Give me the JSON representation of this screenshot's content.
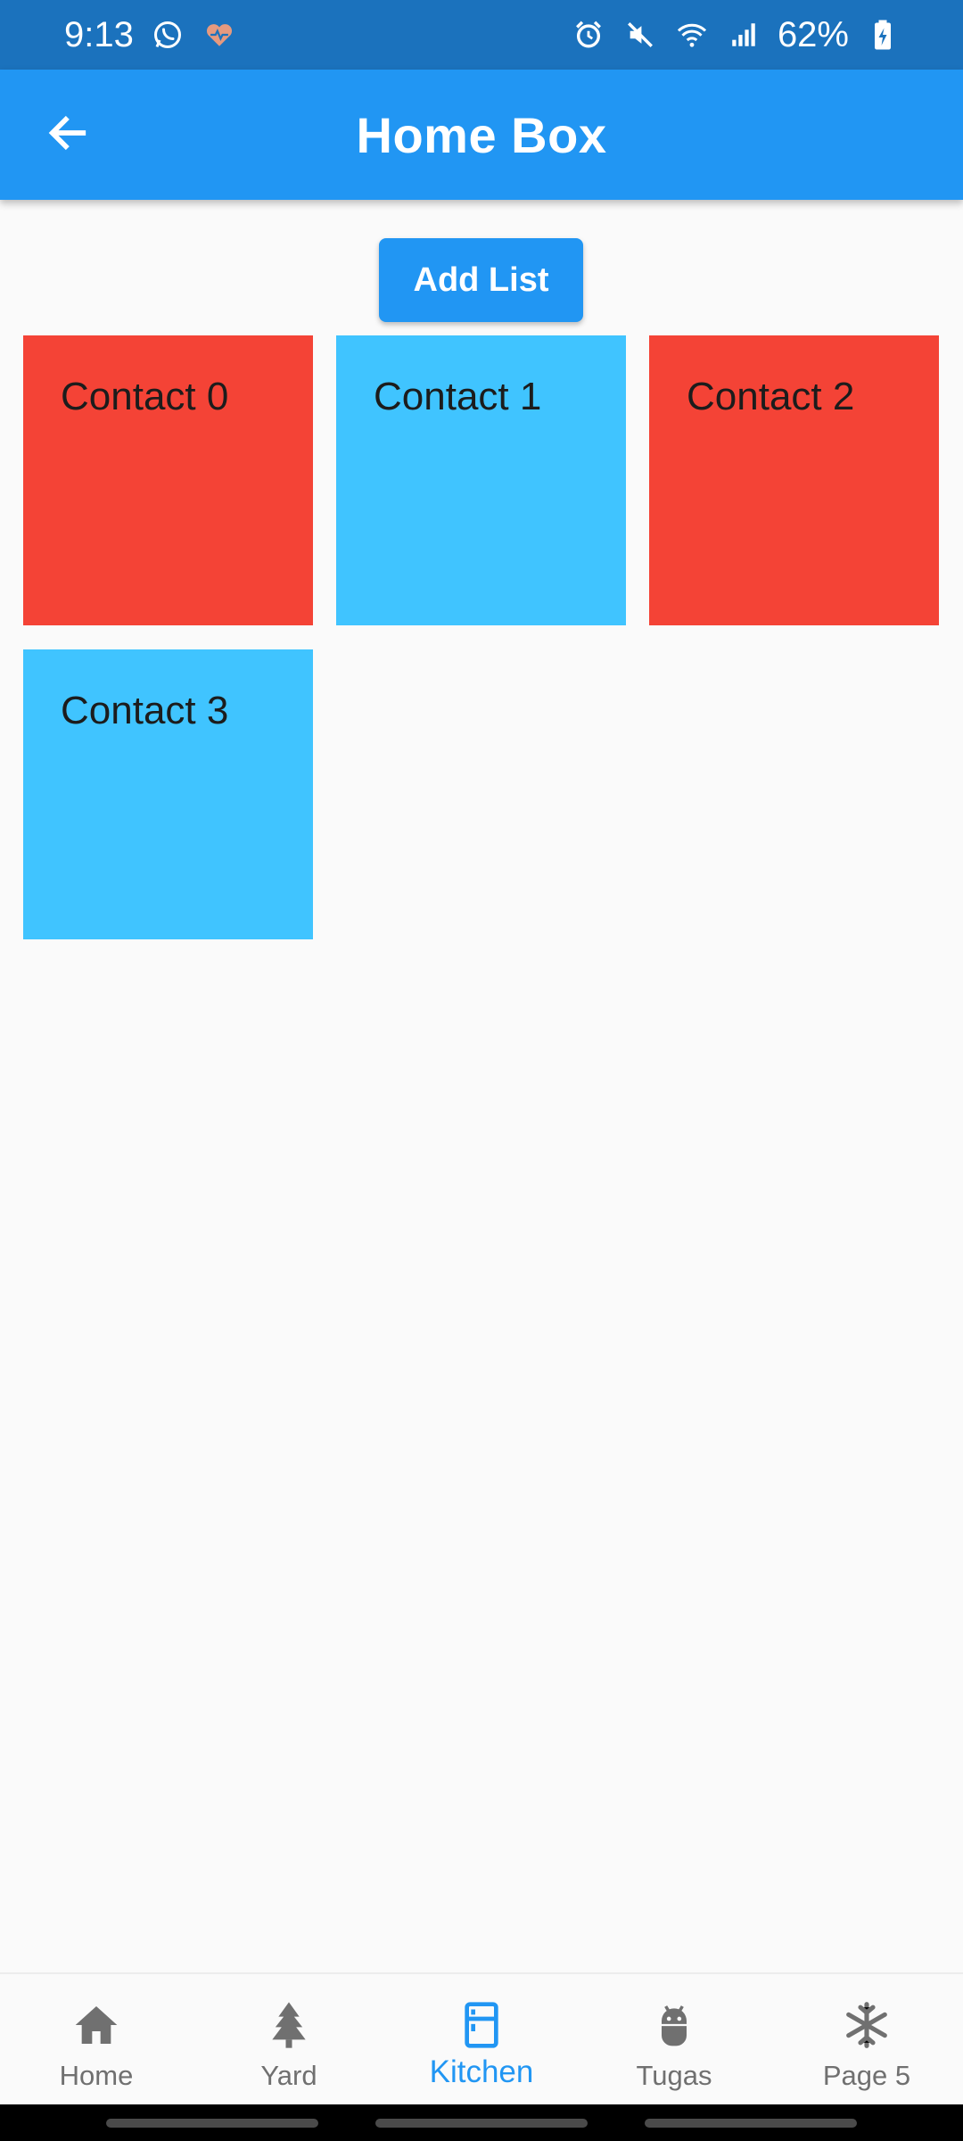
{
  "status_bar": {
    "time": "9:13",
    "battery_percent": "62%",
    "left_icons": [
      "whatsapp-icon",
      "health-heart-icon"
    ],
    "right_icons": [
      "alarm-icon",
      "mute-icon",
      "wifi-icon",
      "signal-icon",
      "battery-charging-icon"
    ]
  },
  "app_bar": {
    "title": "Home Box",
    "back_icon": "arrow-left-icon"
  },
  "actions": {
    "add_list_label": "Add List"
  },
  "contacts": [
    {
      "label": "Contact 0",
      "color": "#f44336"
    },
    {
      "label": "Contact 1",
      "color": "#40c4ff"
    },
    {
      "label": "Contact 2",
      "color": "#f44336"
    },
    {
      "label": "Contact 3",
      "color": "#40c4ff"
    }
  ],
  "bottom_nav": {
    "items": [
      {
        "label": "Home",
        "icon": "home-icon",
        "active": false
      },
      {
        "label": "Yard",
        "icon": "tree-icon",
        "active": false
      },
      {
        "label": "Kitchen",
        "icon": "fridge-icon",
        "active": true
      },
      {
        "label": "Tugas",
        "icon": "android-icon",
        "active": false
      },
      {
        "label": "Page 5",
        "icon": "snowflake-icon",
        "active": false
      }
    ],
    "active_color": "#2196f3",
    "inactive_color": "#707070"
  },
  "colors": {
    "app_bar": "#2196f3",
    "status_bar": "#1b72bd",
    "background": "#fafafa"
  }
}
